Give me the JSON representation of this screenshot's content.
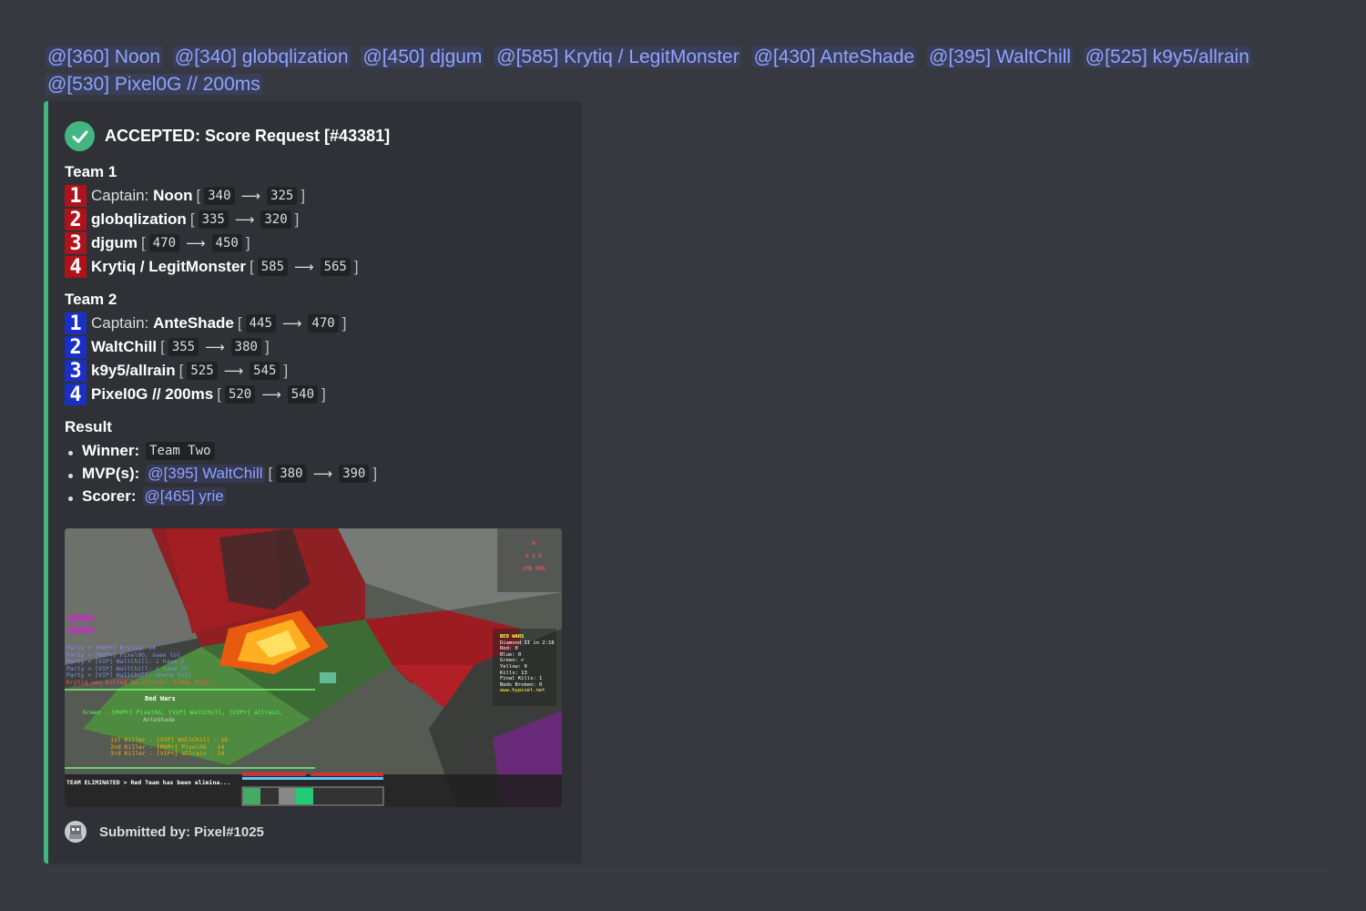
{
  "mentions": [
    "@[360] Noon",
    "@[340] globqlization",
    "@[450] djgum",
    "@[585] Krytiq / LegitMonster",
    "@[430] AnteShade",
    "@[395] WaltChill",
    "@[525] k9y5/allrain",
    "@[530] Pixel0G // 200ms"
  ],
  "embed": {
    "title": "ACCEPTED: Score Request [#43381]",
    "accent_color": "#43b581",
    "team1": {
      "title": "Team 1",
      "color": "#b0121a",
      "players": [
        {
          "num": "1",
          "label": "Captain:",
          "name": "Noon",
          "from": "340",
          "to": "325"
        },
        {
          "num": "2",
          "label": "",
          "name": "globqlization",
          "from": "335",
          "to": "320"
        },
        {
          "num": "3",
          "label": "",
          "name": "djgum",
          "from": "470",
          "to": "450"
        },
        {
          "num": "4",
          "label": "",
          "name": "Krytiq / LegitMonster",
          "from": "585",
          "to": "565"
        }
      ]
    },
    "team2": {
      "title": "Team 2",
      "color": "#1a2fc8",
      "players": [
        {
          "num": "1",
          "label": "Captain:",
          "name": "AnteShade",
          "from": "445",
          "to": "470"
        },
        {
          "num": "2",
          "label": "",
          "name": "WaltChill",
          "from": "355",
          "to": "380"
        },
        {
          "num": "3",
          "label": "",
          "name": "k9y5/allrain",
          "from": "525",
          "to": "545"
        },
        {
          "num": "4",
          "label": "",
          "name": "Pixel0G // 200ms",
          "from": "520",
          "to": "540"
        }
      ]
    },
    "result": {
      "title": "Result",
      "winner_label": "Winner:",
      "winner_value": "Team Two",
      "mvp_label": "MVP(s):",
      "mvp_mention": "@[395] WaltChill",
      "mvp_from": "380",
      "mvp_to": "390",
      "scorer_label": "Scorer:",
      "scorer_mention": "@[465] yrie"
    },
    "arrow": "⟶",
    "bracket_open": "[",
    "bracket_close": "]",
    "screenshot": {
      "chat_lines": [
        "Party > [MVP+] Krytiq: 14",
        "Party > [MVP+] Pixel0G: swae lol",
        "Party > [VIP] WaltChill: i have 1",
        "Party > [VIP] WaltChill: i have 15",
        "Party > [VIP] WaltChill: where [x3]",
        "Krytiq was killed by allrain. FINAL KILL!"
      ],
      "game_title": "Bed Wars",
      "winners_line": "Green - [MVP+] Pixel0G, [VIP] WaltChill, [VIP+] allrain,",
      "winners_line2": "AnteShade",
      "killer1": "1st Killer - [VIP] WaltChill - 16",
      "killer2": "2nd Killer - [MVP+] Pixel0G - 14",
      "killer3": "3rd Killer - [VIP+] allrain - 14",
      "eliminated": "TEAM ELIMINATED > Red Team has been elimina...",
      "sidebar_title": "BED WARS",
      "sidebar_lines": [
        "Diamond II in 2:18",
        "Red: 0",
        "Blue: 0",
        "Green: ✔",
        "Yellow: 0",
        "Kills: 13",
        "Final Kills: 1",
        "Beds Broken: 0",
        "www.hypixel.net"
      ],
      "keys": [
        "W",
        "A",
        "S",
        "D",
        "LMB",
        "RMB"
      ]
    },
    "footer": "Submitted by: Pixel#1025"
  }
}
